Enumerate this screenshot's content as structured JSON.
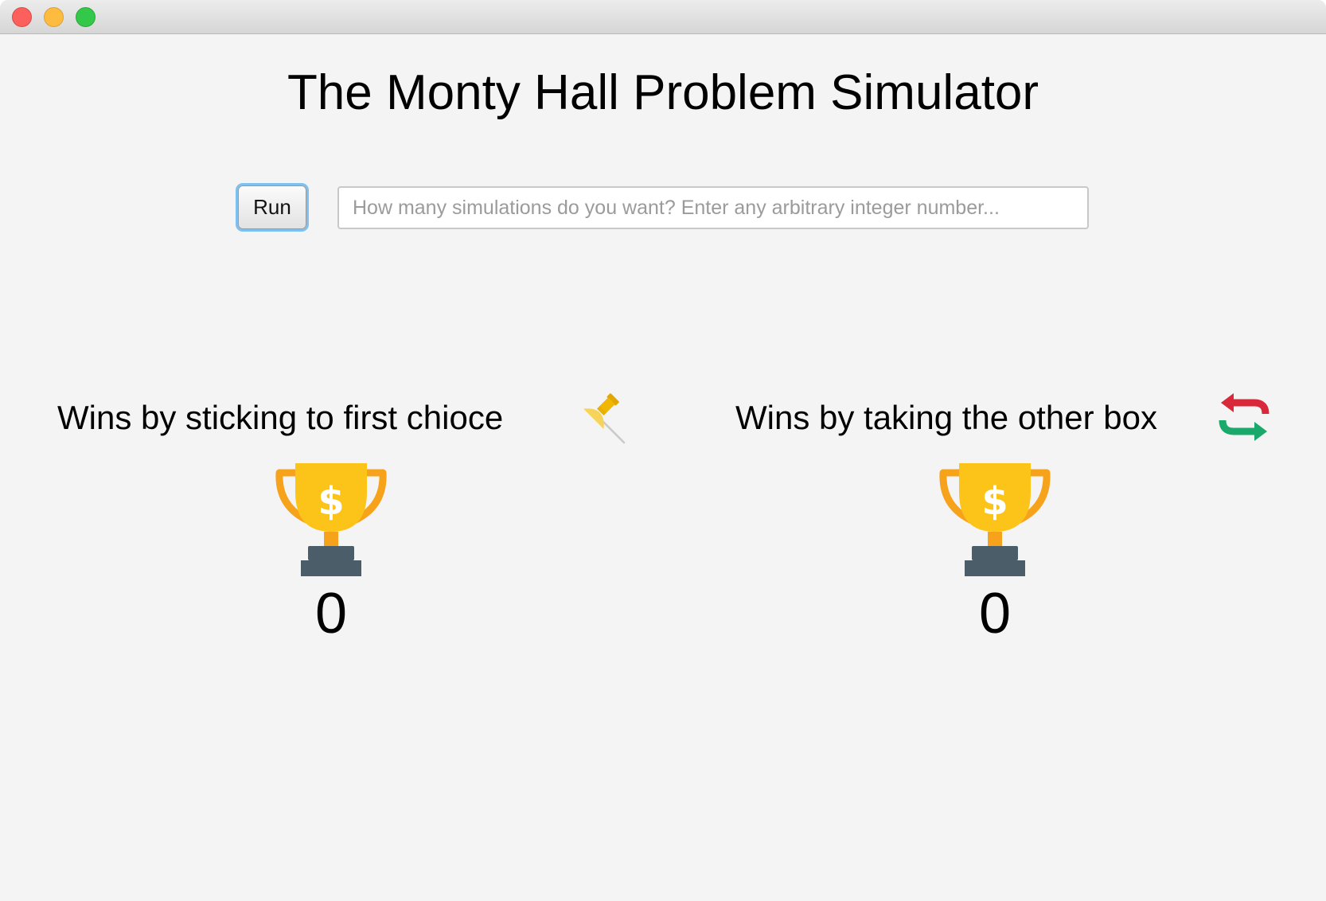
{
  "window": {
    "controls": [
      "close",
      "minimize",
      "zoom"
    ]
  },
  "header": {
    "title": "The Monty Hall Problem Simulator"
  },
  "controls": {
    "run_label": "Run",
    "simulations_input": {
      "value": "",
      "placeholder": "How many simulations do you want? Enter any arbitrary integer number..."
    }
  },
  "results": {
    "stick": {
      "label": "Wins by sticking to first chioce",
      "icon": "pushpin-icon",
      "trophy_icon": "trophy-dollar-icon",
      "count": "0"
    },
    "switch": {
      "label": "Wins by taking the other box",
      "icon": "swap-arrows-icon",
      "trophy_icon": "trophy-dollar-icon",
      "count": "0"
    }
  },
  "colors": {
    "background": "#f4f4f4",
    "focus_ring": "#7ec0f0",
    "trophy_gold": "#fcc419",
    "trophy_handle": "#f7a21b",
    "trophy_base": "#4c5d6a",
    "swap_red": "#d8283a",
    "swap_green": "#1aa86b",
    "pin_yellow": "#f2c94c"
  }
}
